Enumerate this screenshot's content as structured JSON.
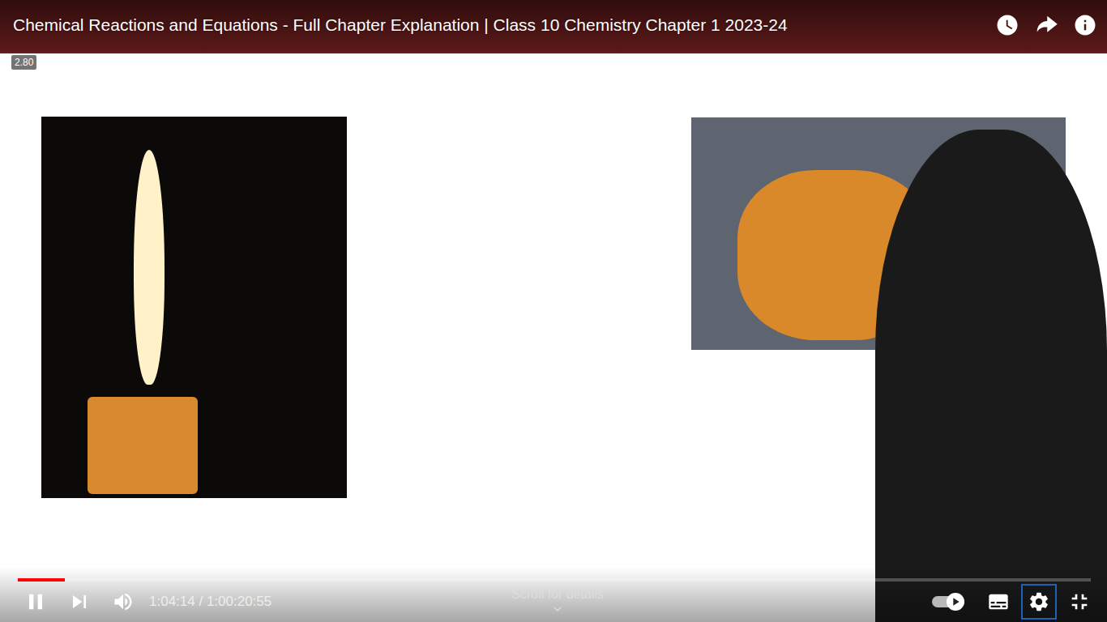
{
  "video": {
    "title": "Chemical Reactions and Equations - Full Chapter Explanation | Class 10 Chemistry Chapter 1 2023-24",
    "speed_badge": "2.80"
  },
  "progress": {
    "level": 0.044
  },
  "time_display": "1:04:14 / 1:00:20:55",
  "hint": "Scroll for details",
  "autoplay": {
    "on": true
  },
  "settings": {
    "selected": true
  }
}
